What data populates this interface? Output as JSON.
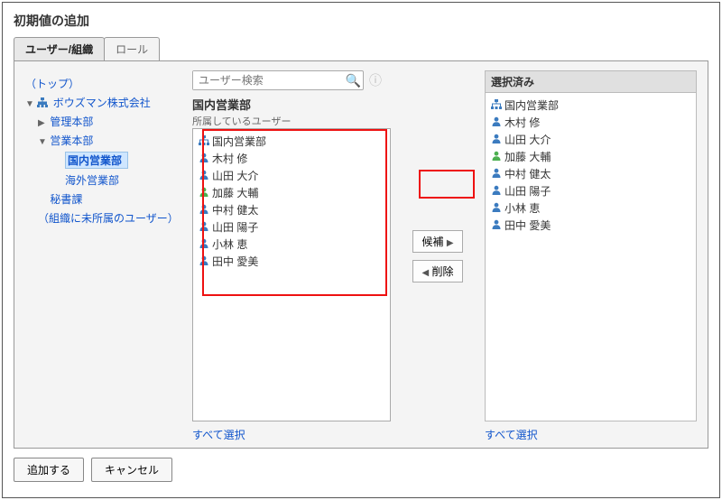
{
  "title": "初期値の追加",
  "tabs": {
    "user_org": "ユーザー/組織",
    "role": "ロール"
  },
  "tree": {
    "top": "（トップ）",
    "org_root": "ボウズマン株式会社",
    "admin": "管理本部",
    "sales": "営業本部",
    "domestic": "国内営業部",
    "overseas": "海外営業部",
    "secretary": "秘書課",
    "unassigned": "（組織に未所属のユーザー）"
  },
  "search": {
    "placeholder": "ユーザー検索"
  },
  "avail": {
    "dept_header": "国内営業部",
    "legend": "所属しているユーザー",
    "items": [
      {
        "kind": "org",
        "label": "国内営業部"
      },
      {
        "kind": "user",
        "label": "木村 修"
      },
      {
        "kind": "user",
        "label": "山田 大介"
      },
      {
        "kind": "user_primary",
        "label": "加藤 大輔"
      },
      {
        "kind": "user",
        "label": "中村 健太"
      },
      {
        "kind": "user",
        "label": "山田 陽子"
      },
      {
        "kind": "user",
        "label": "小林 恵"
      },
      {
        "kind": "user",
        "label": "田中 愛美"
      }
    ],
    "select_all": "すべて選択"
  },
  "transfer": {
    "candidate": "候補",
    "remove": "削除"
  },
  "selected": {
    "header": "選択済み",
    "items": [
      {
        "kind": "org",
        "label": "国内営業部"
      },
      {
        "kind": "user",
        "label": "木村 修"
      },
      {
        "kind": "user",
        "label": "山田 大介"
      },
      {
        "kind": "user_primary",
        "label": "加藤 大輔"
      },
      {
        "kind": "user",
        "label": "中村 健太"
      },
      {
        "kind": "user",
        "label": "山田 陽子"
      },
      {
        "kind": "user",
        "label": "小林 恵"
      },
      {
        "kind": "user",
        "label": "田中 愛美"
      }
    ],
    "select_all": "すべて選択"
  },
  "buttons": {
    "add": "追加する",
    "cancel": "キャンセル"
  }
}
